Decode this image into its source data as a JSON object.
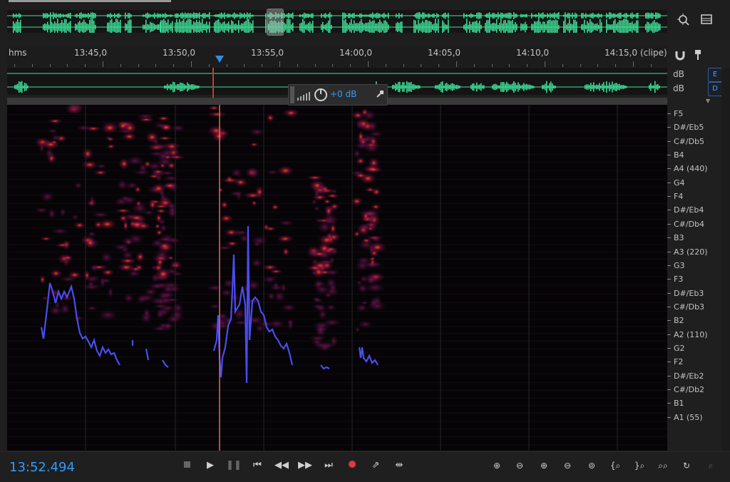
{
  "overview": {
    "zoom_icon": "zoom-navigator-icon",
    "menu_icon": "panel-menu-icon"
  },
  "ruler": {
    "unit_label": "hms",
    "suffix_label": "(clipe)",
    "ticks": [
      "13:45,0",
      "13:50,0",
      "13:55,0",
      "14:00,0",
      "14:05,0",
      "14:10,0",
      "14:15,0"
    ]
  },
  "channels": {
    "top_label": "dB",
    "bottom_label": "dB",
    "top_button": "E",
    "bottom_button": "D"
  },
  "gain_hud": {
    "value": "+0 dB"
  },
  "pitch_axis": {
    "labels": [
      "F5",
      "D#/Eb5",
      "C#/Db5",
      "B4",
      "A4 (440)",
      "G4",
      "F4",
      "D#/Eb4",
      "C#/Db4",
      "B3",
      "A3 (220)",
      "G3",
      "F3",
      "D#/Eb3",
      "C#/Db3",
      "B2",
      "A2 (110)",
      "G2",
      "F2",
      "D#/Eb2",
      "C#/Db2",
      "B1",
      "A1 (55)"
    ]
  },
  "transport": {
    "time": "13:52.494",
    "buttons": [
      {
        "name": "stop-button",
        "icon": "stop-icon"
      },
      {
        "name": "play-button",
        "icon": "play-icon"
      },
      {
        "name": "pause-button",
        "icon": "pause-icon"
      },
      {
        "name": "go-to-start-button",
        "icon": "skip-back-icon"
      },
      {
        "name": "rewind-button",
        "icon": "rewind-icon"
      },
      {
        "name": "fast-forward-button",
        "icon": "fast-forward-icon"
      },
      {
        "name": "go-to-end-button",
        "icon": "skip-forward-icon"
      },
      {
        "name": "record-button",
        "icon": "record-icon"
      },
      {
        "name": "loop-button",
        "icon": "loop-icon"
      },
      {
        "name": "skip-selection-button",
        "icon": "skip-selection-icon"
      }
    ],
    "zoom_buttons": [
      "zoom-in-amplitude-icon",
      "zoom-out-amplitude-icon",
      "zoom-in-time-icon",
      "zoom-out-time-icon",
      "zoom-out-full-icon",
      "zoom-in-start-icon",
      "zoom-in-end-icon",
      "zoom-selection-icon",
      "zoom-reset-icon",
      "zoom-spectral-icon"
    ]
  },
  "colors": {
    "waveform": "#3fe39b",
    "playhead": "#e36a6a",
    "pitch_curve": "#4a4df0",
    "time_text": "#2f9bff"
  }
}
